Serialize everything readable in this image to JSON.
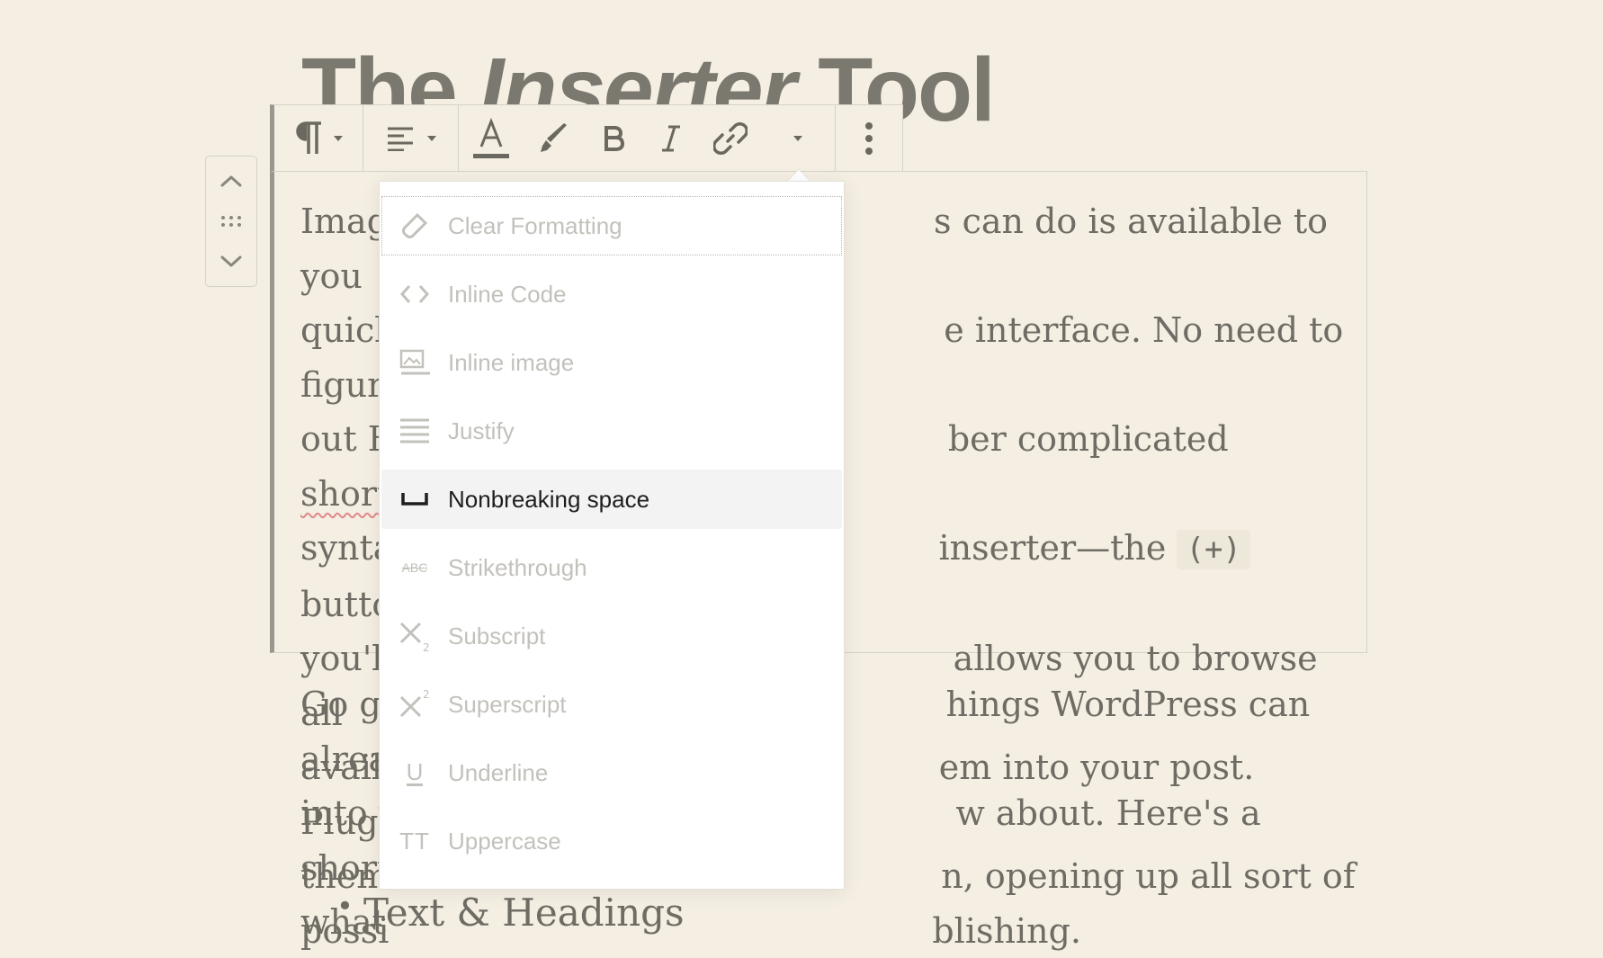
{
  "post": {
    "title_plain": "The ",
    "title_italic": "Inserter",
    "title_end": " Tool",
    "paragraph": {
      "line1": "Imag",
      "line1b": "s can do is available to you",
      "line2": "quick",
      "line2b": "e interface. No need to figure",
      "line3": "out H",
      "line3b": "ber complicated ",
      "line3c": "shortcode",
      "line4": "synta",
      "line4b": " inserter—the ",
      "line4code": "(+)",
      "line4c": " button",
      "line5": "you'll",
      "line5b": " allows you to browse all",
      "line6": "availa",
      "line6b": "em into your post. Plugins and",
      "line7": "them",
      "line7b": "n, opening up all sort of",
      "line8": "possi",
      "line8b": "blishing."
    },
    "paragraph2": {
      "line1": "Go g",
      "line1b": "hings WordPress can already add",
      "line2": "into y",
      "line2b": "w about. Here's a short list of",
      "line3": "what"
    },
    "list_items": [
      "Text & Headings"
    ]
  },
  "toolbar": {
    "icons": [
      "paragraph-icon",
      "align-left-icon",
      "text-color-icon",
      "highlight-icon",
      "bold-icon",
      "italic-icon",
      "link-icon",
      "more-rich-text-icon",
      "more-options-icon"
    ]
  },
  "dropdown": {
    "items": [
      {
        "label": "Clear Formatting",
        "icon": "eraser-icon",
        "state": "focused"
      },
      {
        "label": "Inline Code",
        "icon": "code-icon",
        "state": "disabled"
      },
      {
        "label": "Inline image",
        "icon": "inline-image-icon",
        "state": "disabled"
      },
      {
        "label": "Justify",
        "icon": "justify-icon",
        "state": "disabled"
      },
      {
        "label": "Nonbreaking space",
        "icon": "nonbreaking-space-icon",
        "state": "active"
      },
      {
        "label": "Strikethrough",
        "icon": "strikethrough-icon",
        "state": "disabled"
      },
      {
        "label": "Subscript",
        "icon": "subscript-icon",
        "state": "disabled"
      },
      {
        "label": "Superscript",
        "icon": "superscript-icon",
        "state": "disabled"
      },
      {
        "label": "Underline",
        "icon": "underline-icon",
        "state": "disabled"
      },
      {
        "label": "Uppercase",
        "icon": "uppercase-icon",
        "state": "disabled"
      }
    ],
    "strike_glyph": "ABC",
    "upper_glyph": "TT",
    "underline_glyph": "U"
  },
  "colors": {
    "background": "#f4efe2",
    "text": "#6f6c65",
    "disabled": "#c3c1bb",
    "active_bg": "#f3f3f4"
  }
}
